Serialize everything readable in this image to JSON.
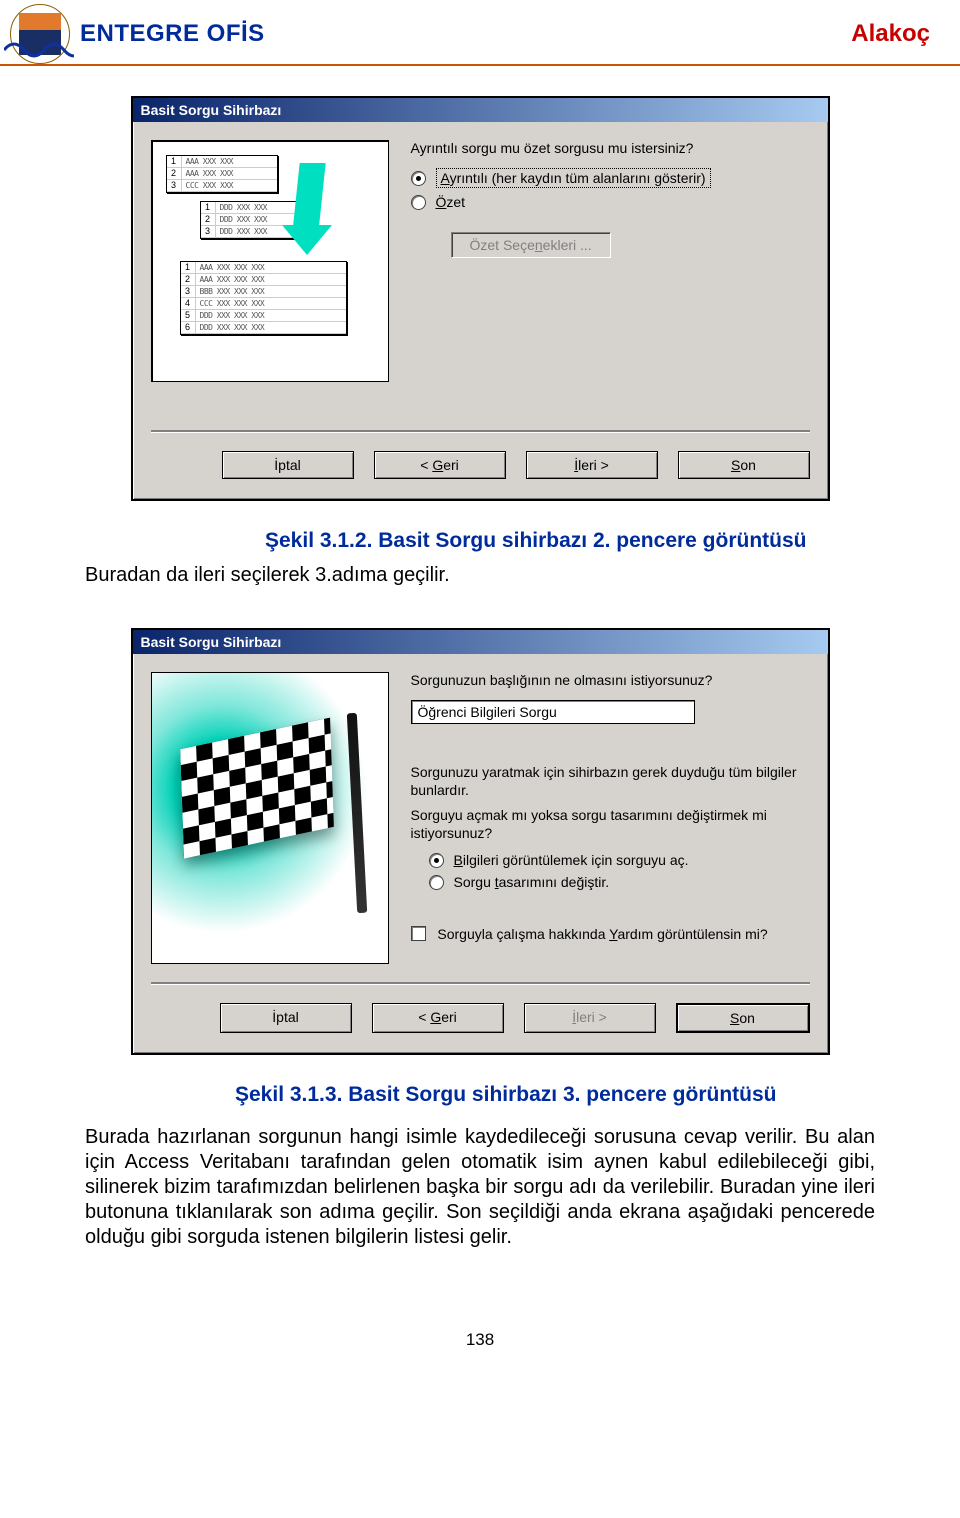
{
  "header": {
    "brand": "ENTEGRE OFİS",
    "right": "Alakoç"
  },
  "dialog1": {
    "title": "Basit Sorgu Sihirbazı",
    "question": "Ayrıntılı sorgu mu özet sorgusu mu istersiniz?",
    "radios": [
      {
        "label": "Ayrıntılı (her kaydın tüm alanlarını gösterir)",
        "checked": true,
        "underline": "A",
        "dotted": true
      },
      {
        "label": "Özet",
        "checked": false,
        "underline": "Ö",
        "dotted": false
      }
    ],
    "summary_btn": "Özet Seçenekleri ...",
    "buttons": {
      "cancel": "İptal",
      "back": "< Geri",
      "next": "İleri >",
      "finish": "Son"
    }
  },
  "intertext": {
    "caption": "Şekil 3.1.2. Basit Sorgu sihirbazı 2. pencere görüntüsü",
    "line": "Buradan da ileri seçilerek 3.adıma geçilir."
  },
  "dialog2": {
    "title": "Basit Sorgu Sihirbazı",
    "question": "Sorgunuzun başlığının ne olmasını istiyorsunuz?",
    "input_value": "Öğrenci Bilgileri Sorgu",
    "info1": "Sorgunuzu yaratmak için sihirbazın gerek duyduğu tüm bilgiler bunlardır.",
    "info2": "Sorguyu açmak mı yoksa sorgu tasarımını değiştirmek mi istiyorsunuz?",
    "radios": [
      {
        "label": "Bilgileri görüntülemek için sorguyu aç.",
        "checked": true,
        "underline": "B"
      },
      {
        "label": "Sorgu tasarımını değiştir.",
        "checked": false,
        "underline": "t"
      }
    ],
    "help_chk": "Sorguyla çalışma hakkında Yardım görüntülensin mi?",
    "buttons": {
      "cancel": "İptal",
      "back": "< Geri",
      "next": "İleri >",
      "finish": "Son"
    }
  },
  "aftertext": {
    "caption": "Şekil 3.1.3. Basit Sorgu sihirbazı 3. pencere görüntüsü",
    "body": "Burada hazırlanan sorgunun hangi isimle kaydedileceği sorusuna cevap verilir. Bu alan için Access Veritabanı tarafından gelen otomatik isim aynen kabul edilebileceği gibi, silinerek bizim tarafımızdan belirlenen başka bir sorgu adı da verilebilir. Buradan yine ileri butonuna tıklanılarak son adıma geçilir. Son seçildiği anda ekrana aşağıdaki pencerede olduğu gibi sorguda istenen bilgilerin listesi gelir."
  },
  "pagenum": "138"
}
